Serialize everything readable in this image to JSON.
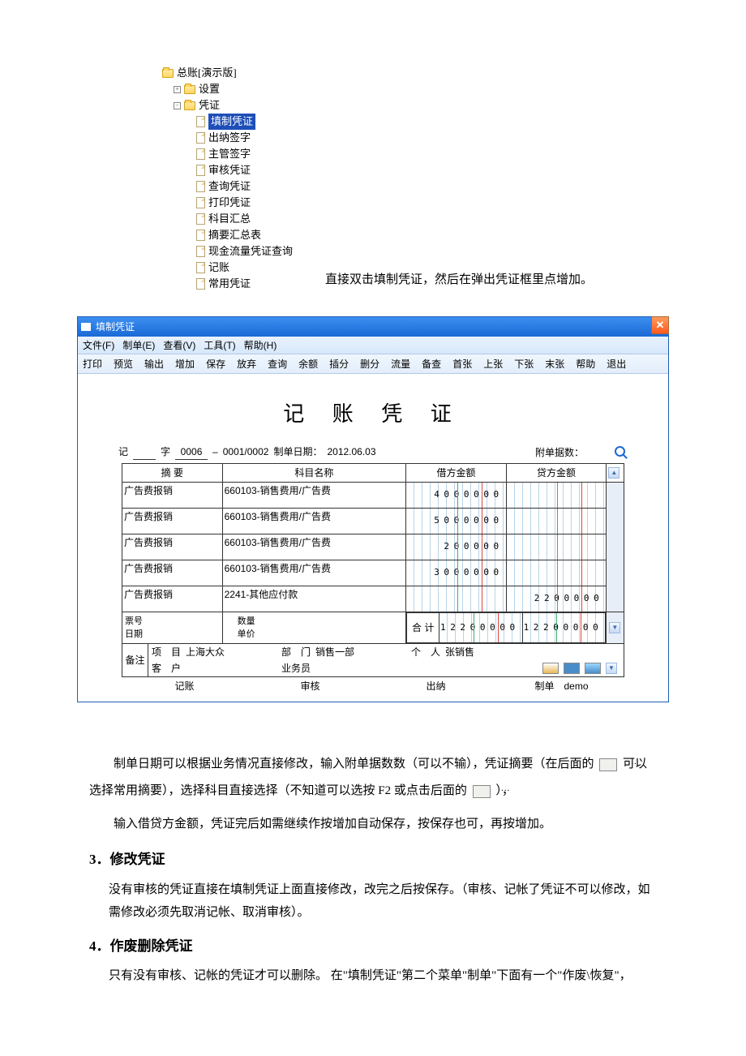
{
  "tree": {
    "root": "总账[演示版]",
    "n1": "设置",
    "n2": "凭证",
    "items": [
      "填制凭证",
      "出纳签字",
      "主管签字",
      "审核凭证",
      "查询凭证",
      "打印凭证",
      "科目汇总",
      "摘要汇总表",
      "现金流量凭证查询",
      "记账",
      "常用凭证"
    ]
  },
  "tree_note": "直接双击填制凭证，然后在弹出凭证框里点增加。",
  "window": {
    "title": "填制凭证",
    "menus": [
      "文件(F)",
      "制单(E)",
      "查看(V)",
      "工具(T)",
      "帮助(H)"
    ],
    "tools": [
      "打印",
      "预览",
      "输出",
      "增加",
      "保存",
      "放弃",
      "查询",
      "余额",
      "插分",
      "删分",
      "流量",
      "备查",
      "首张",
      "上张",
      "下张",
      "末张",
      "帮助",
      "退出"
    ]
  },
  "voucher": {
    "title": "记 账 凭 证",
    "zi_label": "记",
    "zi_label2": "字",
    "number": "0006",
    "page": "0001/0002",
    "date_label": "制单日期：",
    "date": "2012.06.03",
    "attach_label": "附单据数：",
    "attach_count": "",
    "cols": [
      "摘 要",
      "科目名称",
      "借方金额",
      "贷方金额"
    ],
    "rows": [
      {
        "summary": "广告费报销",
        "account": "660103-销售费用/广告费",
        "debit": "4000000",
        "credit": ""
      },
      {
        "summary": "广告费报销",
        "account": "660103-销售费用/广告费",
        "debit": "5000000",
        "credit": ""
      },
      {
        "summary": "广告费报销",
        "account": "660103-销售费用/广告费",
        "debit": "200000",
        "credit": ""
      },
      {
        "summary": "广告费报销",
        "account": "660103-销售费用/广告费",
        "debit": "3000000",
        "credit": ""
      },
      {
        "summary": "广告费报销",
        "account": "2241-其他应付款",
        "debit": "",
        "credit": "2200000"
      }
    ],
    "aux_lines": [
      "票号",
      "日期",
      "数量",
      "单价"
    ],
    "total_label": "合 计",
    "total_debit": "12200000",
    "total_credit": "12200000",
    "notes_label": "备注",
    "notes": {
      "proj_label": "项　目",
      "proj": "上海大众",
      "cust_label": "客　户",
      "cust": "",
      "dept_label": "部　门",
      "dept": "销售一部",
      "op_label": "业务员",
      "op": "",
      "person_label": "个　人",
      "person": "张销售"
    },
    "footer": {
      "jizhang": "记账",
      "shenhe": "审核",
      "chuna": "出纳",
      "zhidan_label": "制单",
      "zhidan": "demo"
    }
  },
  "doc": {
    "p1": "制单日期可以根据业务情况直接修改，输入附单据数数（可以不输），凭证摘要（在后面的",
    "p1b": "可以选择常用摘要），选择科目直接选择（不知道可以选按 F2 或点击后面的",
    "p1c": "），",
    "p2": "输入借贷方金额，凭证完后如需继续作按增加自动保存，按保存也可，再按增加。",
    "h3": "3．修改凭证",
    "p3": "没有审核的凭证直接在填制凭证上面直接修改，改完之后按保存。（审核、记帐了凭证不可以修改，如需修改必须先取消记帐、取消审核）。",
    "h4": "4．作废删除凭证",
    "p4": "只有没有审核、记帐的凭证才可以删除。 在\"填制凭证\"第二个菜单\"制单\"下面有一个\"作废\\恢复\"，"
  }
}
